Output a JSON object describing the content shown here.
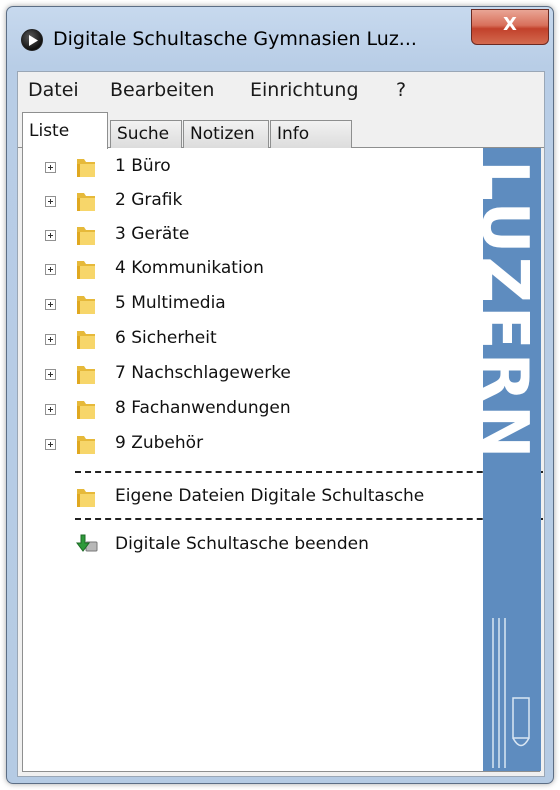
{
  "window": {
    "title": "Digitale Schultasche Gymnasien Luz...",
    "close_label": "X"
  },
  "menu": {
    "items": [
      "Datei",
      "Bearbeiten",
      "Einrichtung",
      "?"
    ]
  },
  "tabs": {
    "items": [
      "Liste",
      "Suche",
      "Notizen",
      "Info"
    ],
    "active": "Liste"
  },
  "tree": {
    "categories": [
      "1 Büro",
      "2 Grafik",
      "3 Geräte",
      "4 Kommunikation",
      "5 Multimedia",
      "6 Sicherheit",
      "7 Nachschlagewerke",
      "8 Fachanwendungen",
      "9 Zubehör"
    ],
    "own_files": "Eigene Dateien Digitale Schultasche",
    "exit": "Digitale Schultasche beenden"
  },
  "logo": {
    "text": "LUZERN",
    "color": "#5e8cbf"
  },
  "colors": {
    "folder": "#f2c94c",
    "close_button": "#c2412b",
    "exit_icon": "#2e9a3a"
  }
}
